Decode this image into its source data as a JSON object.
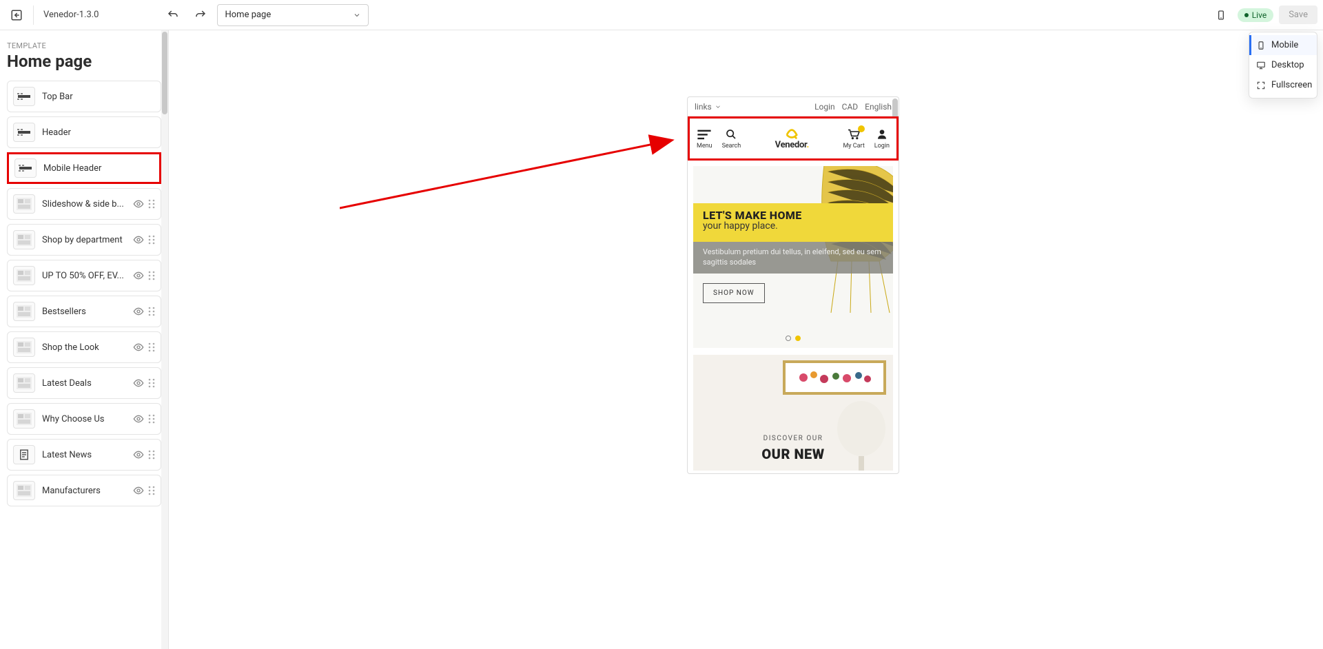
{
  "toolbar": {
    "theme_name": "Venedor-1.3.0",
    "page_select": "Home page",
    "live_label": "Live",
    "save_label": "Save"
  },
  "sidebar": {
    "template_label": "TEMPLATE",
    "page_title": "Home page",
    "sections": [
      {
        "label": "Top Bar",
        "type": "bar",
        "controls": false
      },
      {
        "label": "Header",
        "type": "bar",
        "controls": false
      },
      {
        "label": "Mobile Header",
        "type": "bar",
        "controls": false,
        "highlight": true
      },
      {
        "label": "Slideshow & side b...",
        "type": "img",
        "controls": true
      },
      {
        "label": "Shop by department",
        "type": "img",
        "controls": true
      },
      {
        "label": "UP TO 50% OFF, EV...",
        "type": "img",
        "controls": true
      },
      {
        "label": "Bestsellers",
        "type": "img",
        "controls": true
      },
      {
        "label": "Shop the Look",
        "type": "img",
        "controls": true
      },
      {
        "label": "Latest Deals",
        "type": "img",
        "controls": true
      },
      {
        "label": "Why Choose Us",
        "type": "img",
        "controls": true
      },
      {
        "label": "Latest News",
        "type": "doc",
        "controls": true
      },
      {
        "label": "Manufacturers",
        "type": "img",
        "controls": true
      }
    ]
  },
  "preview": {
    "topbar": {
      "links": "links",
      "login": "Login",
      "currency": "CAD",
      "lang": "English"
    },
    "header": {
      "menu": "Menu",
      "search": "Search",
      "logo": "Venedor",
      "cart": "My Cart",
      "login": "Login"
    },
    "hero": {
      "h1": "LET'S MAKE HOME",
      "h2": "your happy place.",
      "sub": "Vestibulum pretium dui tellus, in eleifend, sed eu sem sagittis sodales",
      "btn": "SHOP NOW"
    },
    "section2": {
      "sub": "DISCOVER OUR",
      "title": "OUR NEW"
    }
  },
  "popover": {
    "mobile": "Mobile",
    "desktop": "Desktop",
    "fullscreen": "Fullscreen"
  }
}
